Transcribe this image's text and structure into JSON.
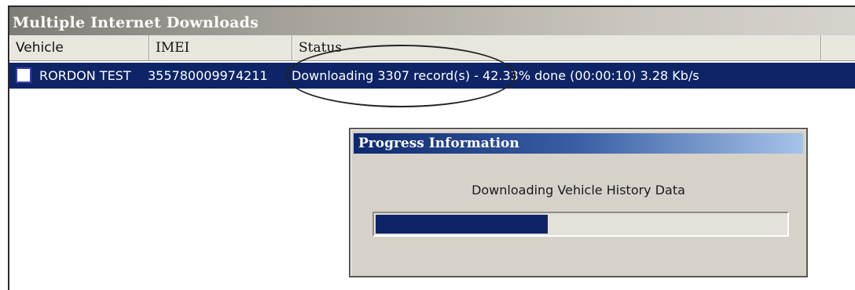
{
  "window": {
    "title": "Multiple Internet Downloads"
  },
  "table": {
    "columns": [
      "Vehicle",
      "IMEI",
      "Status"
    ],
    "rows": [
      {
        "selected": false,
        "vehicle": "RORDON TEST",
        "imei": "355780009974211",
        "status": "Downloading 3307 record(s) - 42.33% done (00:00:10) 3.28 Kb/s"
      }
    ]
  },
  "dialog": {
    "title": "Progress Information",
    "message": "Downloading Vehicle History Data",
    "progress_fraction": 0.42
  },
  "colors": {
    "selection": "#0d2466",
    "progress_fill": "#0d2466",
    "window_bg": "#d6d2ca"
  }
}
